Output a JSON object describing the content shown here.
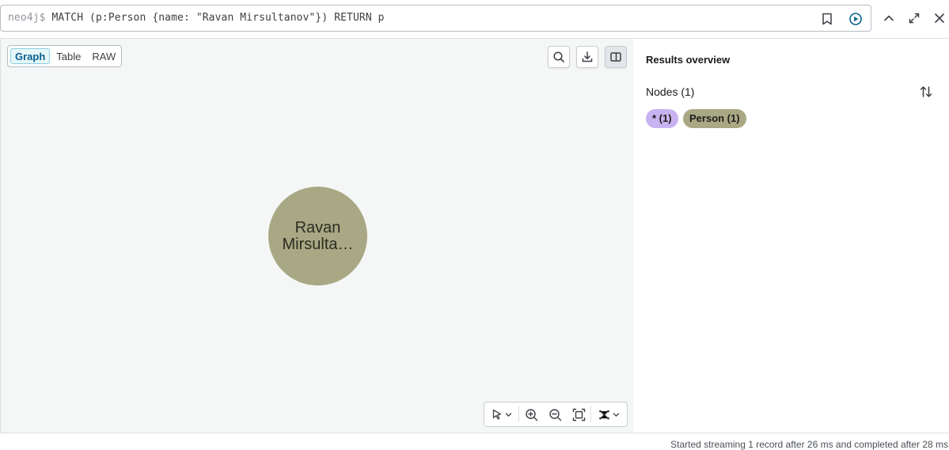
{
  "query_bar": {
    "prompt": "neo4j$",
    "query": "MATCH (p:Person {name: \"Ravan Mirsultanov\"}) RETURN p"
  },
  "view_tabs": [
    {
      "label": "Graph",
      "active": true
    },
    {
      "label": "Table",
      "active": false
    },
    {
      "label": "RAW",
      "active": false
    }
  ],
  "graph": {
    "node": {
      "label": "Ravan\nMirsulta…",
      "line1": "Ravan",
      "line2": "Mirsulta…",
      "color": "#a9a884"
    }
  },
  "overview": {
    "title": "Results overview",
    "nodes_label": "Nodes (1)",
    "pills": [
      {
        "label": "* (1)",
        "color": "#c9b2f0"
      },
      {
        "label": "Person (1)",
        "color": "#a9a884"
      }
    ]
  },
  "status": "Started streaming 1 record after 26 ms and completed after 28 ms",
  "icons": {
    "query_bar": [
      "bookmark-icon",
      "run-icon"
    ],
    "window": [
      "collapse-icon",
      "fullscreen-icon",
      "close-icon"
    ],
    "canvas": [
      "search-icon",
      "download-icon",
      "panel-toggle-icon"
    ],
    "toolbar": [
      "select-mode-icon",
      "zoom-in-icon",
      "zoom-out-icon",
      "fit-icon",
      "layout-icon"
    ]
  },
  "colors": {
    "accent": "#0a6190",
    "canvas_bg": "#f5f6f6"
  }
}
